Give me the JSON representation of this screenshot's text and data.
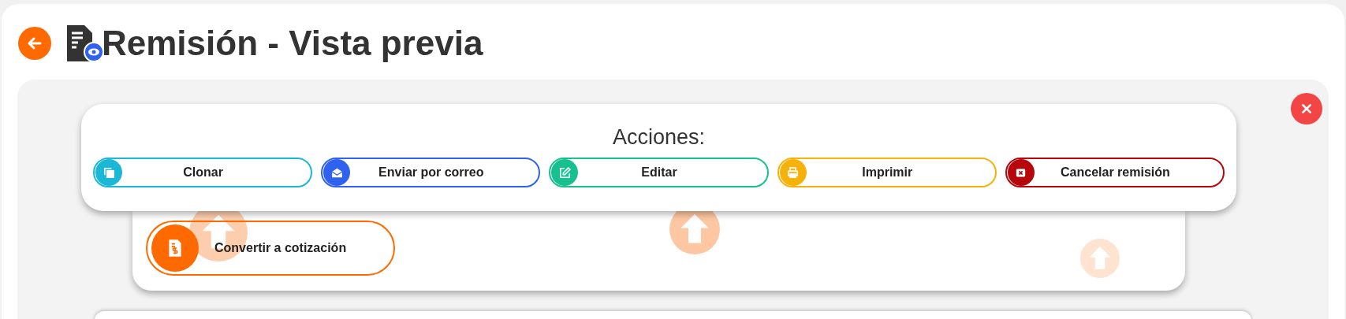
{
  "header": {
    "title": "Remisión - Vista previa"
  },
  "actions": {
    "title": "Acciones:",
    "buttons": [
      {
        "label": "Clonar",
        "kind": "clone",
        "color": "#1ab8d6"
      },
      {
        "label": "Enviar por correo",
        "kind": "mail",
        "color": "#2f62f0"
      },
      {
        "label": "Editar",
        "kind": "edit",
        "color": "#17c08f"
      },
      {
        "label": "Imprimir",
        "kind": "print",
        "color": "#f5b20a"
      },
      {
        "label": "Cancelar remisión",
        "kind": "cancel",
        "color": "#b5070c"
      }
    ]
  },
  "convert_button": {
    "label": "Convertir a cotización"
  }
}
